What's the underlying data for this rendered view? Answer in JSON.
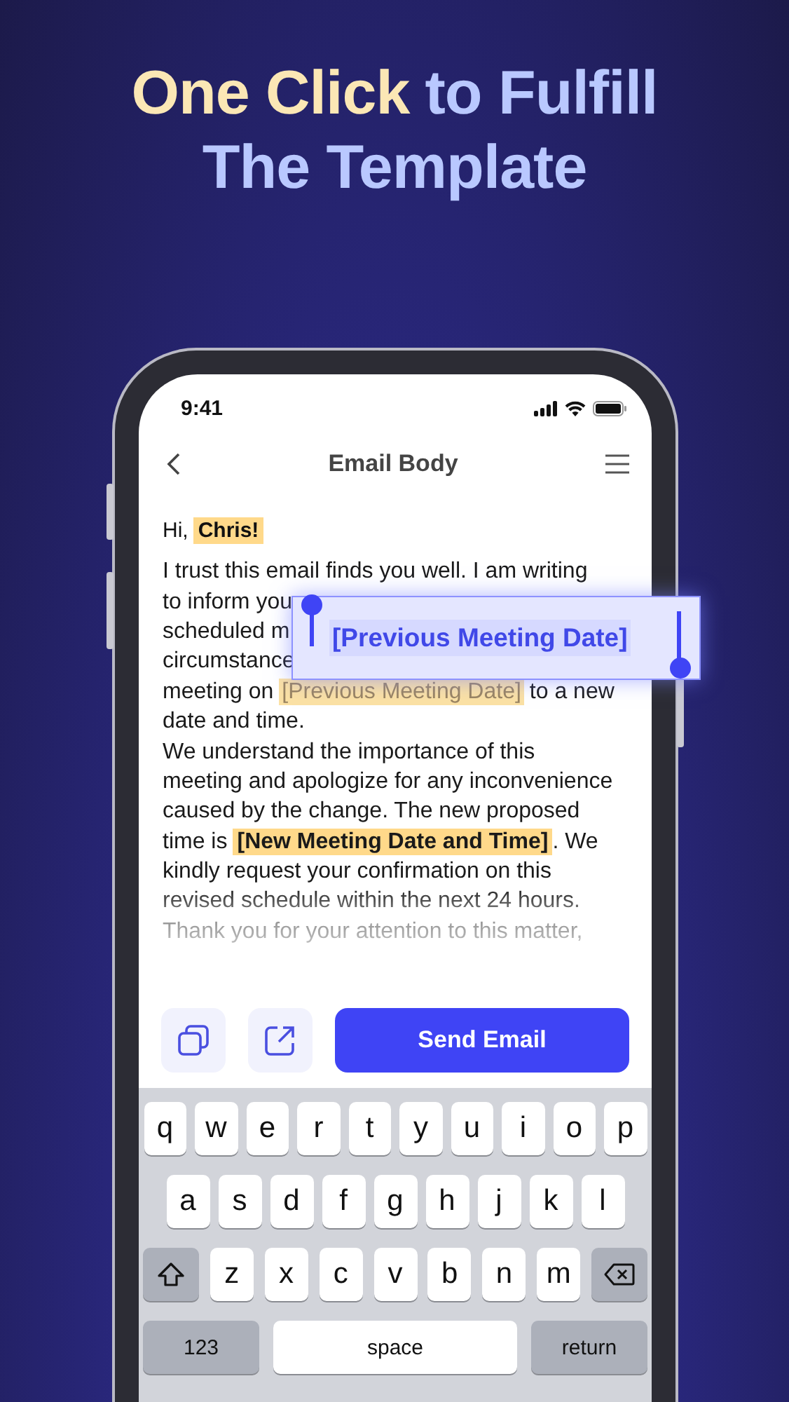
{
  "headline": {
    "lines": [
      [
        {
          "text": "One Click",
          "kind": "accent"
        },
        {
          "text": "to Fulfill",
          "kind": "plain"
        }
      ],
      [
        {
          "text": "The Template",
          "kind": "plain"
        }
      ]
    ]
  },
  "status_bar": {
    "time": "9:41"
  },
  "nav": {
    "title": "Email Body"
  },
  "greeting": [
    {
      "text": "Hi,",
      "kind": "plain"
    },
    {
      "text": "Chris!",
      "kind": "field"
    }
  ],
  "body_lines": [
    [
      {
        "text": "I trust this email finds you well. I am writing",
        "kind": "plain"
      }
    ],
    [
      {
        "text": "to inform you",
        "kind": "plain"
      }
    ],
    [
      {
        "text": "scheduled m",
        "kind": "plain"
      }
    ],
    [
      {
        "text": "circumstance",
        "kind": "plain"
      }
    ],
    [
      {
        "text": "meeting on",
        "kind": "plain"
      },
      {
        "text": "[Previous Meeting Date]",
        "kind": "field-editing"
      },
      {
        "text": "to a new",
        "kind": "plain"
      }
    ],
    [
      {
        "text": "date and time.",
        "kind": "plain"
      }
    ],
    [
      {
        "text": "We understand the importance of this",
        "kind": "plain"
      }
    ],
    [
      {
        "text": "meeting and apologize for any inconvenience",
        "kind": "plain"
      }
    ],
    [
      {
        "text": "caused by the change. The new proposed",
        "kind": "plain"
      }
    ],
    [
      {
        "text": "time is",
        "kind": "plain"
      },
      {
        "text": "[New Meeting Date and Time]",
        "kind": "field"
      },
      {
        "text": ". We",
        "kind": "plain-tight"
      }
    ],
    [
      {
        "text": "kindly request your confirmation on this",
        "kind": "plain"
      }
    ],
    [
      {
        "text": "revised schedule within the next 24 hours.",
        "kind": "plain"
      }
    ],
    [
      {
        "text": "Thank you for your attention to this matter,",
        "kind": "plain"
      }
    ]
  ],
  "edit_popup": {
    "text": "[Previous Meeting Date]"
  },
  "actions": {
    "primary": "Send Email"
  },
  "keyboard": {
    "letter_rows": [
      [
        {
          "kind": "letter",
          "label": "q"
        },
        {
          "kind": "letter",
          "label": "w"
        },
        {
          "kind": "letter",
          "label": "e"
        },
        {
          "kind": "letter",
          "label": "r"
        },
        {
          "kind": "letter",
          "label": "t"
        },
        {
          "kind": "letter",
          "label": "y"
        },
        {
          "kind": "letter",
          "label": "u"
        },
        {
          "kind": "letter",
          "label": "i"
        },
        {
          "kind": "letter",
          "label": "o"
        },
        {
          "kind": "letter",
          "label": "p"
        }
      ],
      [
        {
          "kind": "letter",
          "label": "a"
        },
        {
          "kind": "letter",
          "label": "s"
        },
        {
          "kind": "letter",
          "label": "d"
        },
        {
          "kind": "letter",
          "label": "f"
        },
        {
          "kind": "letter",
          "label": "g"
        },
        {
          "kind": "letter",
          "label": "h"
        },
        {
          "kind": "letter",
          "label": "j"
        },
        {
          "kind": "letter",
          "label": "k"
        },
        {
          "kind": "letter",
          "label": "l"
        }
      ],
      [
        {
          "kind": "shift"
        },
        {
          "kind": "letter",
          "label": "z"
        },
        {
          "kind": "letter",
          "label": "x"
        },
        {
          "kind": "letter",
          "label": "c"
        },
        {
          "kind": "letter",
          "label": "v"
        },
        {
          "kind": "letter",
          "label": "b"
        },
        {
          "kind": "letter",
          "label": "n"
        },
        {
          "kind": "letter",
          "label": "m"
        },
        {
          "kind": "delete"
        }
      ]
    ],
    "bottom_keys": {
      "numbers": "123",
      "space": "space",
      "return": "return"
    }
  }
}
